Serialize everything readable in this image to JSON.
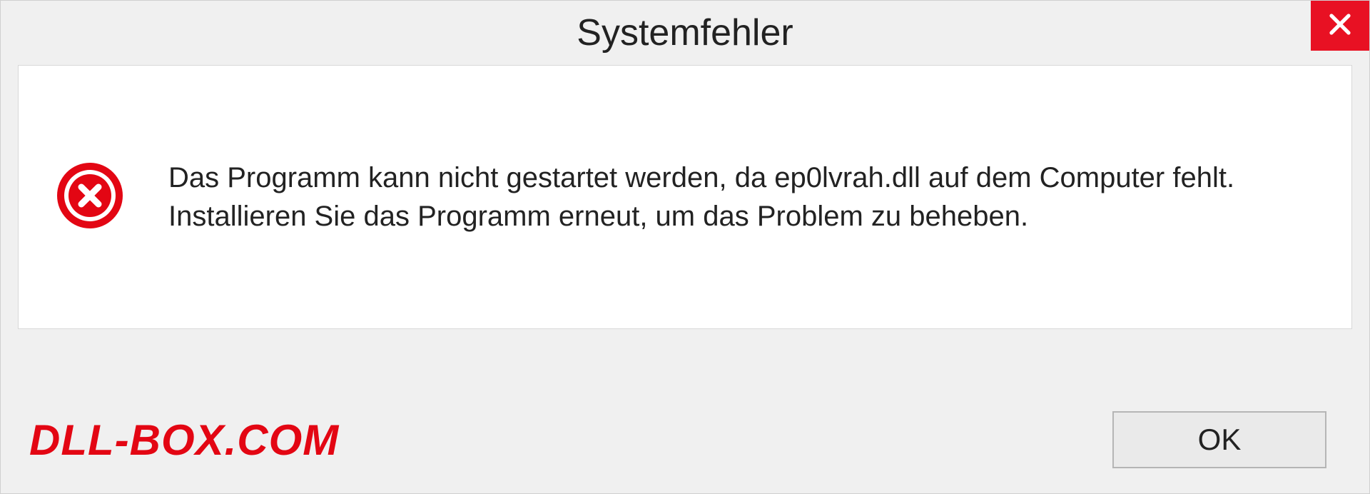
{
  "dialog": {
    "title": "Systemfehler",
    "message": "Das Programm kann nicht gestartet werden, da ep0lvrah.dll auf dem Computer fehlt. Installieren Sie das Programm erneut, um das Problem zu beheben.",
    "ok_label": "OK"
  },
  "watermark": "DLL-BOX.COM",
  "colors": {
    "close_bg": "#e81123",
    "error_icon": "#e30613",
    "watermark": "#e30613"
  }
}
